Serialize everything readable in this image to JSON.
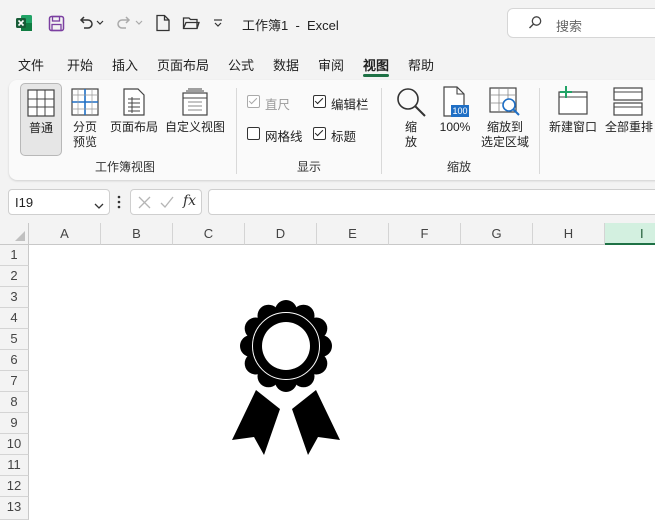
{
  "titlebar": {
    "title": "工作簿1  -  Excel",
    "search_placeholder": "搜索"
  },
  "tabs": [
    {
      "label": "文件"
    },
    {
      "label": "开始"
    },
    {
      "label": "插入"
    },
    {
      "label": "页面布局"
    },
    {
      "label": "公式"
    },
    {
      "label": "数据"
    },
    {
      "label": "审阅"
    },
    {
      "label": "视图"
    },
    {
      "label": "帮助"
    }
  ],
  "ribbon": {
    "normal": "普通",
    "page_break_1": "分页",
    "page_break_2": "预览",
    "page_layout": "页面布局",
    "custom_view": "自定义视图",
    "group_workbook_views": "工作簿视图",
    "ruler": "直尺",
    "formula_bar": "编辑栏",
    "gridlines": "网格线",
    "headings": "标题",
    "group_show": "显示",
    "zoom_1": "缩",
    "zoom_2": "放",
    "zoom_100": "100%",
    "zoom_100_badge": "100",
    "zoom_sel_1": "缩放到",
    "zoom_sel_2": "选定区域",
    "group_zoom": "缩放",
    "new_window": "新建窗口",
    "arrange_all": "全部重排"
  },
  "formula_bar": {
    "name_box": "I19",
    "fx": "fx",
    "value": ""
  },
  "columns": [
    "A",
    "B",
    "C",
    "D",
    "E",
    "F",
    "G",
    "H",
    "I"
  ],
  "rows": [
    "1",
    "2",
    "3",
    "4",
    "5",
    "6",
    "7",
    "8",
    "9",
    "10",
    "11",
    "12",
    "13"
  ],
  "colors": {
    "accent": "#1e7145",
    "excel_green": "#107c41"
  }
}
